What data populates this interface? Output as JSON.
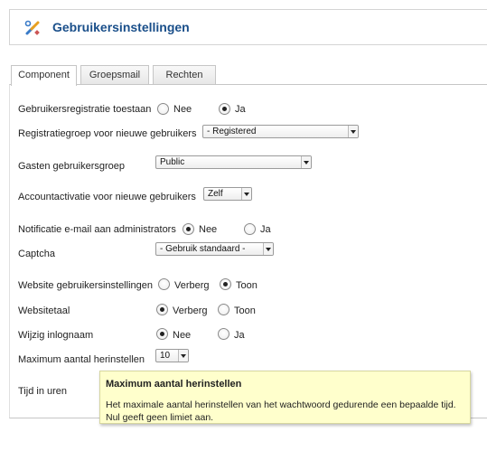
{
  "header": {
    "title": "Gebruikersinstellingen",
    "icon": "tools-icon"
  },
  "tabs": [
    {
      "label": "Component",
      "active": true
    },
    {
      "label": "Groepsmail",
      "active": false
    },
    {
      "label": "Rechten",
      "active": false
    }
  ],
  "fields": {
    "user_registration": {
      "label": "Gebruikersregistratie toestaan",
      "options": [
        "Nee",
        "Ja"
      ],
      "selected": "Ja"
    },
    "registration_group": {
      "label": "Registratiegroep voor nieuwe gebruikers",
      "value": "- Registered"
    },
    "guest_group": {
      "label": "Gasten gebruikersgroep",
      "value": "Public"
    },
    "account_activation": {
      "label": "Accountactivatie voor nieuwe gebruikers",
      "value": "Zelf"
    },
    "admin_notification": {
      "label": "Notificatie e-mail aan administrators",
      "options": [
        "Nee",
        "Ja"
      ],
      "selected": "Nee"
    },
    "captcha": {
      "label": "Captcha",
      "value": "- Gebruik standaard -"
    },
    "frontend_params": {
      "label": "Website gebruikersinstellingen",
      "options": [
        "Verberg",
        "Toon"
      ],
      "selected": "Toon"
    },
    "site_language": {
      "label": "Websitetaal",
      "options": [
        "Verberg",
        "Toon"
      ],
      "selected": "Verberg"
    },
    "change_username": {
      "label": "Wijzig inlognaam",
      "options": [
        "Nee",
        "Ja"
      ],
      "selected": "Nee"
    },
    "max_resets": {
      "label": "Maximum aantal herinstellen",
      "value": "10"
    },
    "reset_time": {
      "label": "Tijd in uren"
    }
  },
  "tooltip": {
    "title": "Maximum aantal herinstellen",
    "body": "Het maximale aantal herinstellen van het wachtwoord gedurende een bepaalde tijd. Nul geeft geen limiet aan."
  }
}
